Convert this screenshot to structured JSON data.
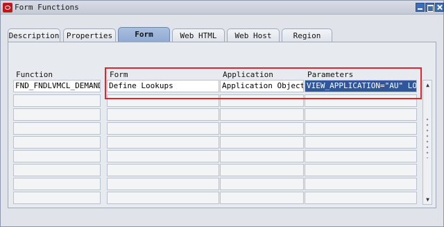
{
  "window": {
    "title": "Form Functions"
  },
  "tabs": [
    {
      "label": "Description",
      "active": false
    },
    {
      "label": "Properties",
      "active": false
    },
    {
      "label": "Form",
      "active": true
    },
    {
      "label": "Web HTML",
      "active": false
    },
    {
      "label": "Web Host",
      "active": false
    },
    {
      "label": "Region",
      "active": false
    }
  ],
  "table": {
    "columns": [
      "Function",
      "Form",
      "Application",
      "Parameters"
    ],
    "rows": [
      {
        "function": "FND_FNDLVMCL_DEMAND_C",
        "form": "Define Lookups",
        "application": "Application Object L",
        "parameters": "VIEW_APPLICATION=\"AU\" LOOKU"
      }
    ],
    "empty_rows": 8
  },
  "colors": {
    "accent": "#30579c",
    "highlight_border": "#e0262b"
  },
  "icons": {
    "app": "oracle-icon",
    "minimize": "minimize-icon",
    "maximize": "maximize-icon",
    "close": "close-icon",
    "scroll_up": "arrow-up-icon",
    "scroll_down": "arrow-down-icon"
  }
}
